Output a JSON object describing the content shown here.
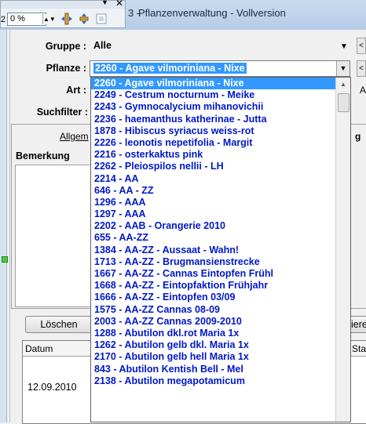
{
  "window": {
    "title": "Pflanzenverwaltung - Vollversion",
    "title_prefix": "3 -"
  },
  "toolbar": {
    "zoom_value": "0 %",
    "left_fragment": "2"
  },
  "form": {
    "gruppe_label": "Gruppe :",
    "gruppe_value": "Alle",
    "pflanze_label": "Pflanze :",
    "pflanze_value": "2260 - Agave vilmoriniana - Nixe",
    "art_label": "Art :",
    "suchfilter_label": "Suchfilter :",
    "side_btn_label": "<",
    "art_right_fragment": "A"
  },
  "panel": {
    "tab_allgemein_fragment": "Allgem",
    "tab_right_fragment": "g",
    "bemerkung_label": "Bemerkung",
    "loeschen_button": "Löschen",
    "right_button_fragment": "iere"
  },
  "grid": {
    "col_datum": "Datum",
    "col_sta": "Sta",
    "row1_date": "12.09.2010"
  },
  "dropdown": {
    "items": [
      "2260 - Agave vilmoriniana - Nixe",
      "2249 - Cestrum nocturnum - Meike",
      "2243 - Gymnocalycium mihanovichii",
      "2236 - haemanthus katherinae - Jutta",
      "1878 - Hibiscus syriacus weiss-rot",
      "2226 - leonotis nepetifolia - Margit",
      "2216 - osterkaktus pink",
      "2262 - Pleiospilos nellii - LH",
      "2214 - AA",
      "646 - AA - ZZ",
      "1296 - AAA",
      "1297 - AAA",
      "2202 - AAB - Orangerie 2010",
      "655 - AA-ZZ",
      "1384 - AA-ZZ - Aussaat - Wahn!",
      "1713 - AA-ZZ - Brugmansienstrecke",
      "1667 - AA-ZZ - Cannas Eintopfen Frühl",
      "1668 - AA-ZZ - Eintopfaktion Frühjahr",
      "1666 - AA-ZZ - Eintopfen 03/09",
      "1575 - AA-ZZ Cannas 08-09",
      "2003 - AA-ZZ Cannas 2009-2010",
      "1288 - Abutilon dkl.rot Maria 1x",
      "1262 - Abutilon gelb dkl. Maria 1x",
      "2170 - Abutilon gelb hell Maria 1x",
      "843 - Abutilon Kentish Bell - Mel",
      "2138 - Abutilon megapotamicum"
    ],
    "selected_index": 0
  }
}
